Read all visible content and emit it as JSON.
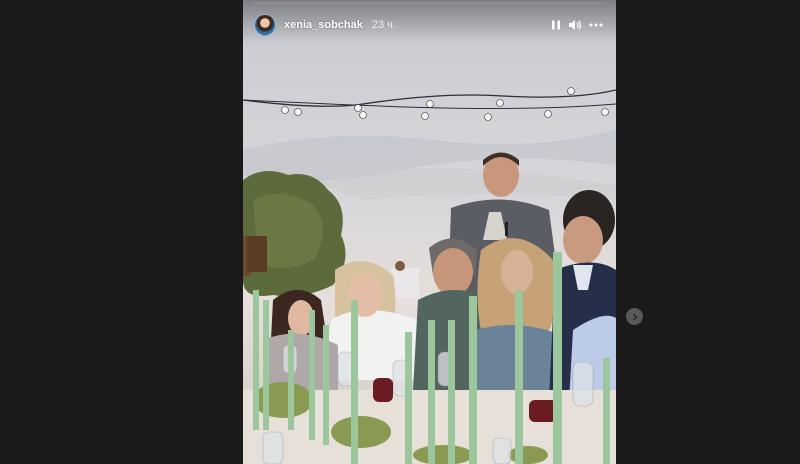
{
  "story": {
    "username": "xenia_sobchak",
    "timestamp": "23 ч.",
    "progress": 0.0,
    "avatar_icon": "user-avatar-icon",
    "controls": {
      "pause_icon": "pause-icon",
      "volume_icon": "volume-icon",
      "more_icon": "more-options-icon"
    },
    "media_description_icon": "story-photo"
  },
  "navigation": {
    "next_icon": "chevron-right-icon"
  },
  "colors": {
    "page_background": "#1a1a1a",
    "header_text": "#ffffff",
    "candle_green": "#9cc79c"
  }
}
